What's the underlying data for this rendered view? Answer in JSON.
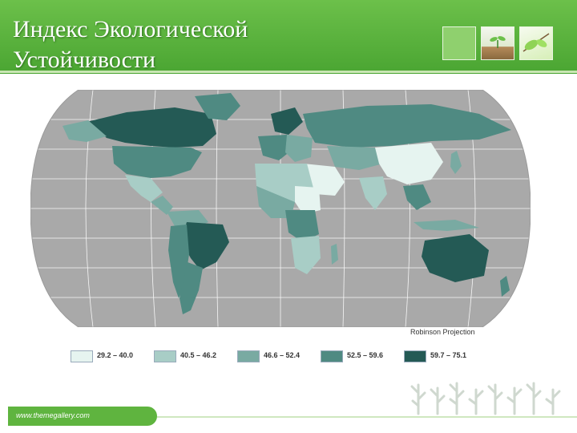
{
  "slide": {
    "title": "Индекс Экологической Устойчивости",
    "footer_url": "www.themegallery.com"
  },
  "map": {
    "projection_label": "Robinson Projection",
    "colors": {
      "ocean": "#ffffff",
      "nodata": "#a9a9a9",
      "c1": "#e6f4f0",
      "c2": "#a8cdc6",
      "c3": "#79aaa2",
      "c4": "#4f8a82",
      "c5": "#245a55"
    }
  },
  "legend": [
    {
      "label": "29.2 – 40.0",
      "color": "#e6f4f0"
    },
    {
      "label": "40.5 – 46.2",
      "color": "#a8cdc6"
    },
    {
      "label": "46.6 – 52.4",
      "color": "#79aaa2"
    },
    {
      "label": "52.5 – 59.6",
      "color": "#4f8a82"
    },
    {
      "label": "59.7 – 75.1",
      "color": "#245a55"
    }
  ]
}
